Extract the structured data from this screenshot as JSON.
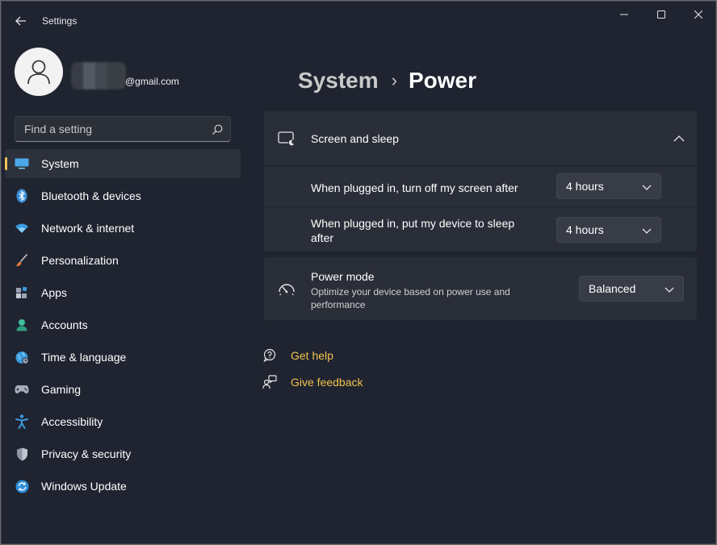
{
  "window": {
    "title": "Settings"
  },
  "account": {
    "email": "@gmail.com"
  },
  "search": {
    "placeholder": "Find a setting"
  },
  "sidebar": {
    "items": [
      {
        "label": "System",
        "icon": "system-display-icon",
        "active": true
      },
      {
        "label": "Bluetooth & devices",
        "icon": "bluetooth-icon"
      },
      {
        "label": "Network & internet",
        "icon": "wifi-icon"
      },
      {
        "label": "Personalization",
        "icon": "paintbrush-icon"
      },
      {
        "label": "Apps",
        "icon": "apps-icon"
      },
      {
        "label": "Accounts",
        "icon": "person-icon"
      },
      {
        "label": "Time & language",
        "icon": "globe-clock-icon"
      },
      {
        "label": "Gaming",
        "icon": "gamepad-icon"
      },
      {
        "label": "Accessibility",
        "icon": "accessibility-icon"
      },
      {
        "label": "Privacy & security",
        "icon": "shield-icon"
      },
      {
        "label": "Windows Update",
        "icon": "update-icon"
      }
    ]
  },
  "breadcrumb": {
    "parent": "System",
    "separator": "›",
    "current": "Power"
  },
  "screen_sleep": {
    "title": "Screen and sleep",
    "expanded": true,
    "rows": [
      {
        "label": "When plugged in, turn off my screen after",
        "value": "4 hours"
      },
      {
        "label": "When plugged in, put my device to sleep after",
        "value": "4 hours"
      }
    ]
  },
  "power_mode": {
    "title": "Power mode",
    "description": "Optimize your device based on power use and performance",
    "value": "Balanced"
  },
  "links": {
    "help": "Get help",
    "feedback": "Give feedback"
  },
  "colors": {
    "background": "#1f2430",
    "card": "#2a2e38",
    "accent": "#f0c05a",
    "link": "#f2c14e"
  }
}
